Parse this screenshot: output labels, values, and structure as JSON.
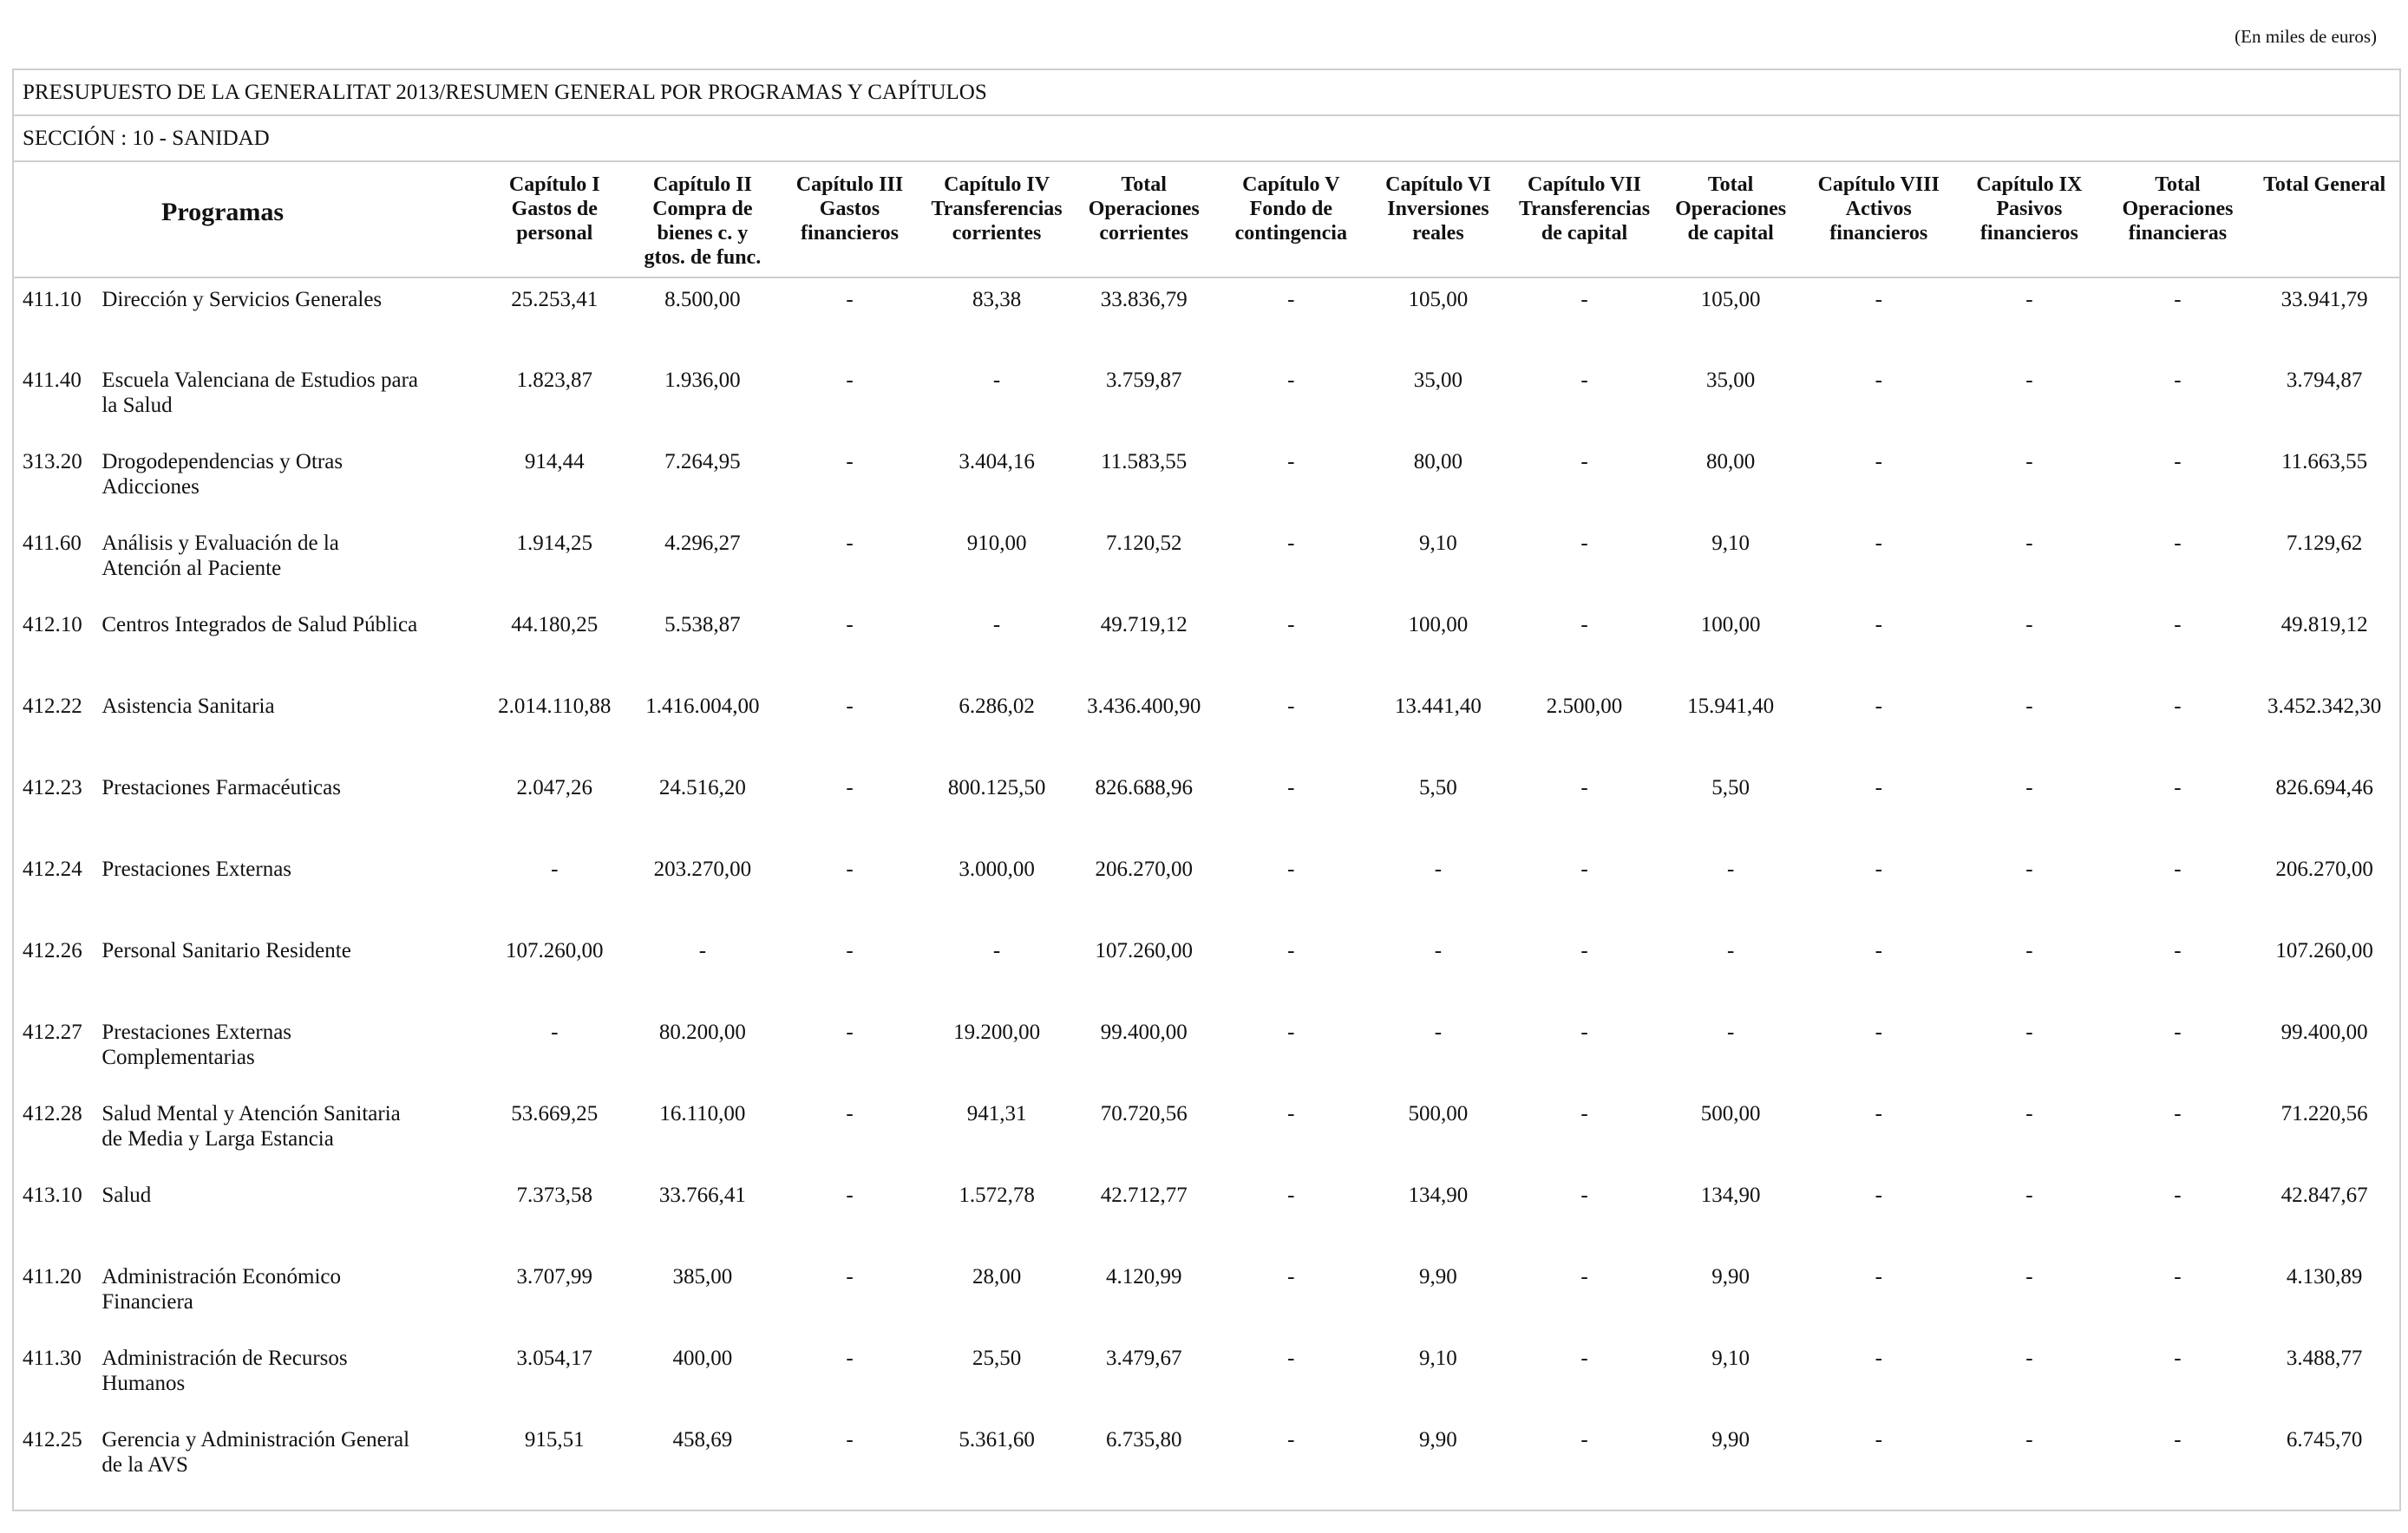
{
  "units_note": "(En miles de euros)",
  "title": "PRESUPUESTO DE LA GENERALITAT 2013/RESUMEN GENERAL POR PROGRAMAS Y CAPÍTULOS",
  "section": "SECCIÓN : 10  -  SANIDAD",
  "headers": {
    "programas": "Programas",
    "cols": [
      [
        "Capítulo I",
        "Gastos de",
        "personal"
      ],
      [
        "Capítulo II",
        "Compra de",
        "bienes c. y",
        "gtos. de func."
      ],
      [
        "Capítulo III",
        "Gastos",
        "financieros"
      ],
      [
        "Capítulo IV",
        "Transferencias",
        "corrientes"
      ],
      [
        "Total",
        "Operaciones",
        "corrientes"
      ],
      [
        "Capítulo V",
        "Fondo de",
        "contingencia"
      ],
      [
        "Capítulo VI",
        "Inversiones",
        "reales"
      ],
      [
        "Capítulo VII",
        "Transferencias",
        "de capital"
      ],
      [
        "Total",
        "Operaciones",
        "de capital"
      ],
      [
        "Capítulo VIII",
        "Activos",
        "financieros"
      ],
      [
        "Capítulo IX",
        "Pasivos",
        "financieros"
      ],
      [
        "Total",
        "Operaciones",
        "financieras"
      ],
      [
        "Total General"
      ]
    ]
  },
  "rows": [
    {
      "code": "411.10",
      "name": [
        "Dirección y Servicios Generales"
      ],
      "values": [
        "25.253,41",
        "8.500,00",
        "-",
        "83,38",
        "33.836,79",
        "-",
        "105,00",
        "-",
        "105,00",
        "-",
        "-",
        "-",
        "33.941,79"
      ]
    },
    {
      "code": "411.40",
      "name": [
        "Escuela Valenciana de Estudios para",
        "la Salud"
      ],
      "values": [
        "1.823,87",
        "1.936,00",
        "-",
        "-",
        "3.759,87",
        "-",
        "35,00",
        "-",
        "35,00",
        "-",
        "-",
        "-",
        "3.794,87"
      ]
    },
    {
      "code": "313.20",
      "name": [
        "Drogodependencias y Otras",
        "Adicciones"
      ],
      "values": [
        "914,44",
        "7.264,95",
        "-",
        "3.404,16",
        "11.583,55",
        "-",
        "80,00",
        "-",
        "80,00",
        "-",
        "-",
        "-",
        "11.663,55"
      ]
    },
    {
      "code": "411.60",
      "name": [
        "Análisis y Evaluación de la",
        "Atención al Paciente"
      ],
      "values": [
        "1.914,25",
        "4.296,27",
        "-",
        "910,00",
        "7.120,52",
        "-",
        "9,10",
        "-",
        "9,10",
        "-",
        "-",
        "-",
        "7.129,62"
      ]
    },
    {
      "code": "412.10",
      "name": [
        "Centros Integrados de Salud Pública"
      ],
      "values": [
        "44.180,25",
        "5.538,87",
        "-",
        "-",
        "49.719,12",
        "-",
        "100,00",
        "-",
        "100,00",
        "-",
        "-",
        "-",
        "49.819,12"
      ]
    },
    {
      "code": "412.22",
      "name": [
        "Asistencia Sanitaria"
      ],
      "values": [
        "2.014.110,88",
        "1.416.004,00",
        "-",
        "6.286,02",
        "3.436.400,90",
        "-",
        "13.441,40",
        "2.500,00",
        "15.941,40",
        "-",
        "-",
        "-",
        "3.452.342,30"
      ]
    },
    {
      "code": "412.23",
      "name": [
        "Prestaciones Farmacéuticas"
      ],
      "values": [
        "2.047,26",
        "24.516,20",
        "-",
        "800.125,50",
        "826.688,96",
        "-",
        "5,50",
        "-",
        "5,50",
        "-",
        "-",
        "-",
        "826.694,46"
      ]
    },
    {
      "code": "412.24",
      "name": [
        "Prestaciones Externas"
      ],
      "values": [
        "-",
        "203.270,00",
        "-",
        "3.000,00",
        "206.270,00",
        "-",
        "-",
        "-",
        "-",
        "-",
        "-",
        "-",
        "206.270,00"
      ]
    },
    {
      "code": "412.26",
      "name": [
        "Personal Sanitario Residente"
      ],
      "values": [
        "107.260,00",
        "-",
        "-",
        "-",
        "107.260,00",
        "-",
        "-",
        "-",
        "-",
        "-",
        "-",
        "-",
        "107.260,00"
      ]
    },
    {
      "code": "412.27",
      "name": [
        "Prestaciones  Externas",
        "Complementarias"
      ],
      "values": [
        "-",
        "80.200,00",
        "-",
        "19.200,00",
        "99.400,00",
        "-",
        "-",
        "-",
        "-",
        "-",
        "-",
        "-",
        "99.400,00"
      ]
    },
    {
      "code": "412.28",
      "name": [
        "Salud Mental y Atención Sanitaria",
        "de Media y Larga Estancia"
      ],
      "values": [
        "53.669,25",
        "16.110,00",
        "-",
        "941,31",
        "70.720,56",
        "-",
        "500,00",
        "-",
        "500,00",
        "-",
        "-",
        "-",
        "71.220,56"
      ]
    },
    {
      "code": "413.10",
      "name": [
        "Salud"
      ],
      "values": [
        "7.373,58",
        "33.766,41",
        "-",
        "1.572,78",
        "42.712,77",
        "-",
        "134,90",
        "-",
        "134,90",
        "-",
        "-",
        "-",
        "42.847,67"
      ]
    },
    {
      "code": "411.20",
      "name": [
        "Administración Económico",
        "Financiera"
      ],
      "values": [
        "3.707,99",
        "385,00",
        "-",
        "28,00",
        "4.120,99",
        "-",
        "9,90",
        "-",
        "9,90",
        "-",
        "-",
        "-",
        "4.130,89"
      ]
    },
    {
      "code": "411.30",
      "name": [
        "Administración de Recursos",
        "Humanos"
      ],
      "values": [
        "3.054,17",
        "400,00",
        "-",
        "25,50",
        "3.479,67",
        "-",
        "9,10",
        "-",
        "9,10",
        "-",
        "-",
        "-",
        "3.488,77"
      ]
    },
    {
      "code": "412.25",
      "name": [
        "Gerencia y Administración General",
        "de la AVS"
      ],
      "values": [
        "915,51",
        "458,69",
        "-",
        "5.361,60",
        "6.735,80",
        "-",
        "9,90",
        "-",
        "9,90",
        "-",
        "-",
        "-",
        "6.745,70"
      ]
    }
  ]
}
